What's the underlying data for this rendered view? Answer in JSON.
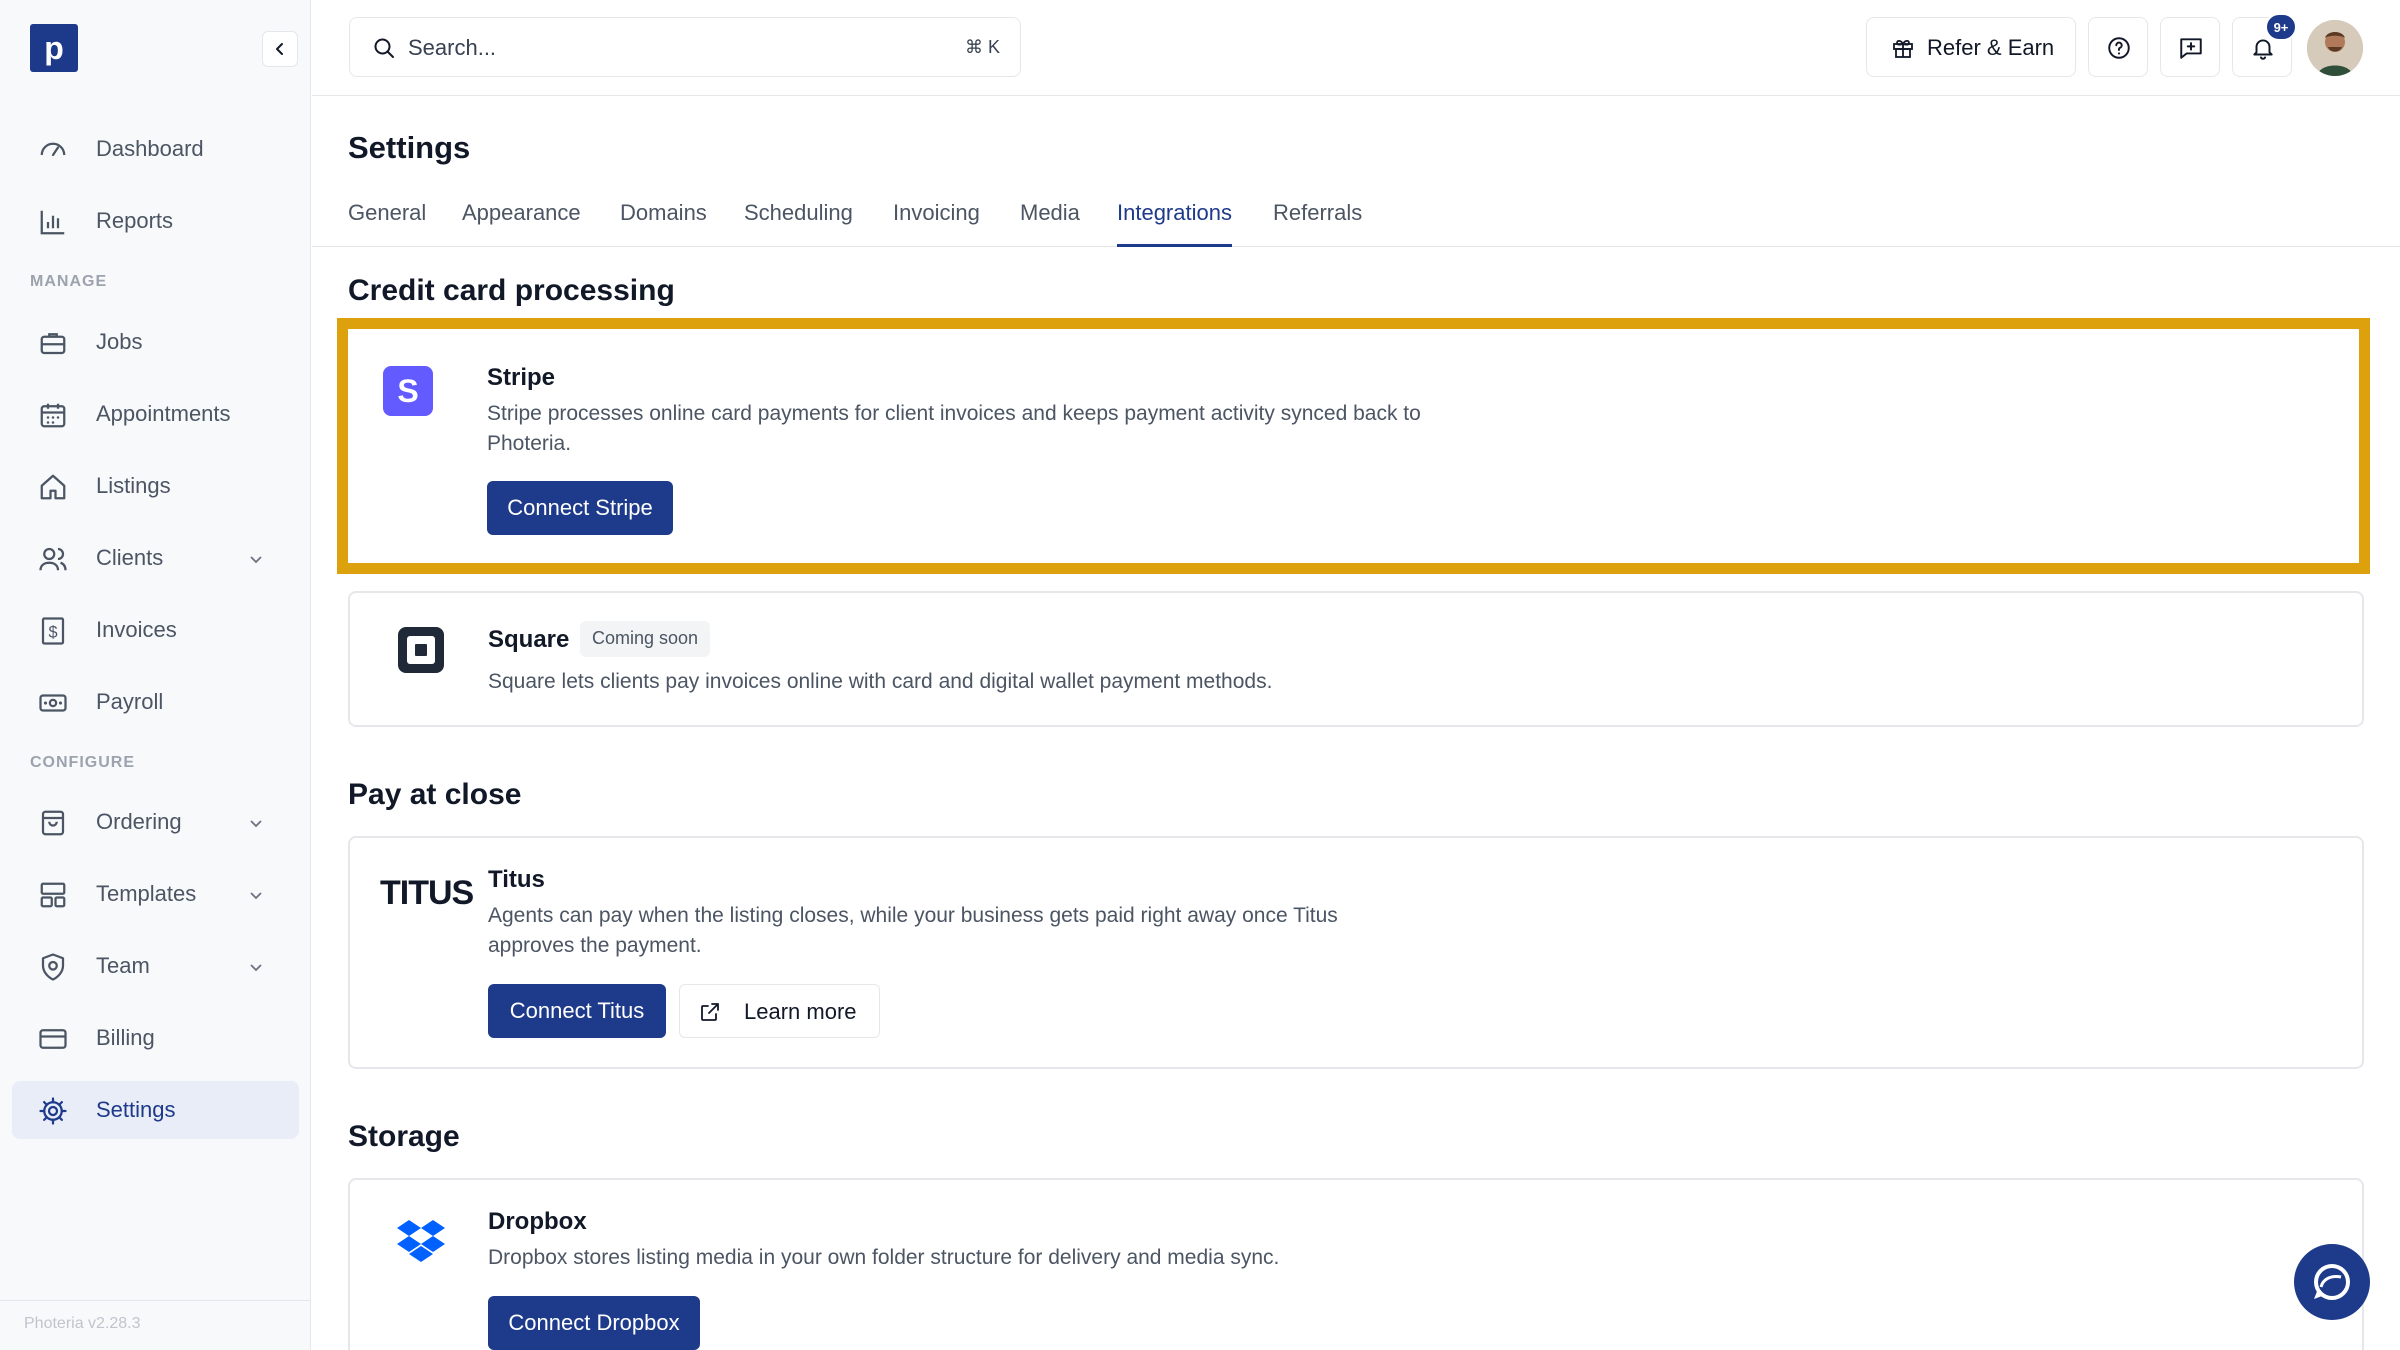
{
  "app": {
    "logo_letter": "p",
    "version": "Photeria v2.28.3"
  },
  "sidebar": {
    "items_top": [
      {
        "label": "Dashboard",
        "icon": "gauge-icon"
      },
      {
        "label": "Reports",
        "icon": "bar-chart-icon"
      }
    ],
    "manage_label": "MANAGE",
    "manage_items": [
      {
        "label": "Jobs",
        "icon": "briefcase-icon"
      },
      {
        "label": "Appointments",
        "icon": "calendar-icon"
      },
      {
        "label": "Listings",
        "icon": "home-icon"
      },
      {
        "label": "Clients",
        "icon": "users-icon",
        "expandable": true
      },
      {
        "label": "Invoices",
        "icon": "invoice-icon"
      },
      {
        "label": "Payroll",
        "icon": "cash-icon"
      }
    ],
    "configure_label": "CONFIGURE",
    "configure_items": [
      {
        "label": "Ordering",
        "icon": "shopping-bag-icon",
        "expandable": true
      },
      {
        "label": "Templates",
        "icon": "layout-icon",
        "expandable": true
      },
      {
        "label": "Team",
        "icon": "shield-icon",
        "expandable": true
      },
      {
        "label": "Billing",
        "icon": "credit-card-icon"
      },
      {
        "label": "Settings",
        "icon": "gear-icon",
        "active": true
      }
    ]
  },
  "topbar": {
    "search_placeholder": "Search...",
    "search_shortcut": "⌘ K",
    "refer_label": "Refer & Earn",
    "notification_count": "9+"
  },
  "page": {
    "title": "Settings",
    "tabs": [
      "General",
      "Appearance",
      "Domains",
      "Scheduling",
      "Invoicing",
      "Media",
      "Integrations",
      "Referrals"
    ],
    "active_tab": "Integrations"
  },
  "sections": {
    "credit_card": {
      "title": "Credit card processing",
      "stripe": {
        "name": "Stripe",
        "desc_line1": "Stripe processes online card payments for client invoices and keeps payment activity synced back to",
        "desc_line2": "Photeria.",
        "button": "Connect Stripe"
      },
      "square": {
        "name": "Square",
        "badge": "Coming soon",
        "desc": "Square lets clients pay invoices online with card and digital wallet payment methods."
      }
    },
    "pay_at_close": {
      "title": "Pay at close",
      "titus": {
        "logo_text": "TITUS",
        "name": "Titus",
        "desc_line1": "Agents can pay when the listing closes, while your business gets paid right away once Titus",
        "desc_line2": "approves the payment.",
        "button": "Connect Titus",
        "learn_more": "Learn more"
      }
    },
    "storage": {
      "title": "Storage",
      "dropbox": {
        "name": "Dropbox",
        "desc": "Dropbox stores listing media in your own folder structure for delivery and media sync.",
        "button": "Connect Dropbox"
      }
    }
  },
  "colors": {
    "brand": "#1e3a8a",
    "highlight": "#dca10d",
    "stripe": "#635bff"
  }
}
